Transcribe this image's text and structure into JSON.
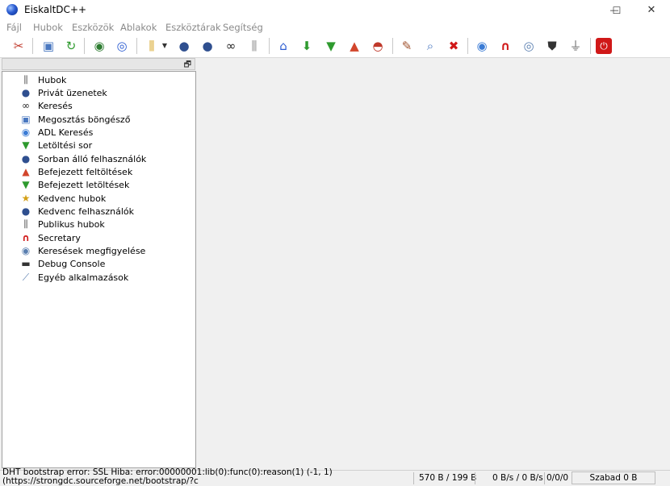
{
  "window": {
    "title": "EiskaltDC++",
    "minimize_glyph": "—",
    "maximize_glyph": "☐",
    "close_glyph": "✕"
  },
  "menu": [
    "Fájl",
    "Hubok",
    "Eszközök",
    "Ablakok",
    "Eszköztárak",
    "Segítség"
  ],
  "toolbar": {
    "icons": [
      "settings-tools-icon",
      "file-list-icon",
      "refresh-icon",
      "connect-icon",
      "disconnect-icon",
      "public-hubs-icon",
      "dropdown-arrow-icon",
      "favorite-users-icon",
      "user-icon",
      "search-binoculars-icon",
      "hub-icon",
      "home-icon",
      "download-queue-icon",
      "finished-downloads-icon",
      "finished-uploads-icon",
      "speed-limit-icon",
      "clear-icon",
      "find-icon",
      "close-all-icon",
      "adl-search-icon",
      "secretary-icon",
      "search-spy-icon",
      "shield-icon",
      "filter-icon",
      "quit-icon"
    ]
  },
  "panel": {
    "restore_glyph": "🗗"
  },
  "sidebar": {
    "items": [
      {
        "label": "Hubok",
        "icon": "hub-pole-icon",
        "glyph": "⫼",
        "color": "#6a6a6a"
      },
      {
        "label": "Privát üzenetek",
        "icon": "private-message-icon",
        "glyph": "●",
        "color": "#2f4f8f"
      },
      {
        "label": "Keresés",
        "icon": "binoculars-icon",
        "glyph": "∞",
        "color": "#222222"
      },
      {
        "label": "Megosztás böngésző",
        "icon": "share-browser-icon",
        "glyph": "▣",
        "color": "#4a78c0"
      },
      {
        "label": "ADL Keresés",
        "icon": "adl-search-icon",
        "glyph": "◉",
        "color": "#3a7bd5"
      },
      {
        "label": "Letöltési sor",
        "icon": "download-queue-icon",
        "glyph": "▼",
        "color": "#2e9a2e"
      },
      {
        "label": "Sorban álló felhasználók",
        "icon": "waiting-users-icon",
        "glyph": "●",
        "color": "#2f4f8f"
      },
      {
        "label": "Befejezett feltöltések",
        "icon": "finished-uploads-icon",
        "glyph": "▲",
        "color": "#d2462c"
      },
      {
        "label": "Befejezett letöltések",
        "icon": "finished-downloads-icon",
        "glyph": "▼",
        "color": "#2e9a2e"
      },
      {
        "label": "Kedvenc hubok",
        "icon": "favorite-hubs-icon",
        "glyph": "★",
        "color": "#d4a017"
      },
      {
        "label": "Kedvenc felhasználók",
        "icon": "favorite-users-icon",
        "glyph": "●",
        "color": "#2f4f8f"
      },
      {
        "label": "Publikus hubok",
        "icon": "public-hubs-icon",
        "glyph": "⫼",
        "color": "#6a6a6a"
      },
      {
        "label": "Secretary",
        "icon": "magnet-icon",
        "glyph": "∩",
        "color": "#d01818"
      },
      {
        "label": "Keresések megfigyelése",
        "icon": "search-spy-icon",
        "glyph": "◉",
        "color": "#5a7fb0"
      },
      {
        "label": "Debug Console",
        "icon": "console-icon",
        "glyph": "▬",
        "color": "#333333"
      },
      {
        "label": "Egyéb alkalmazások",
        "icon": "other-apps-icon",
        "glyph": "⟋",
        "color": "#5a7fb0"
      }
    ]
  },
  "status": {
    "message": "DHT bootstrap error: SSL Hiba: error:00000001:lib(0):func(0):reason(1) (-1, 1) (https://strongdc.sourceforge.net/bootstrap/?c",
    "transfer": "570 B / 199 B",
    "speed": "0 B/s / 0 B/s",
    "slots": "0/0/0",
    "free": "Szabad 0 B"
  },
  "colors": {
    "accent": "#2a5bd1",
    "menu_text": "#8a8a8a",
    "quit_red": "#d01818"
  }
}
